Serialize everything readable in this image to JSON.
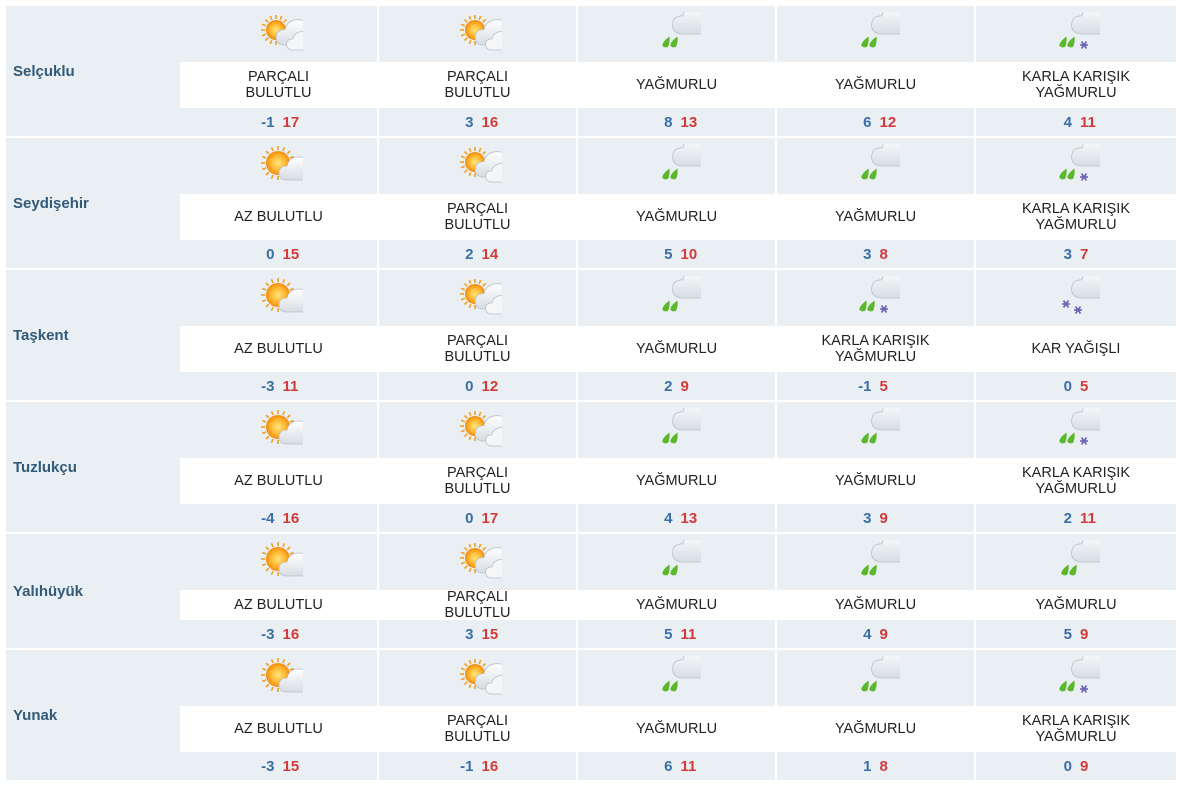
{
  "rows": [
    {
      "city": "Selçuklu",
      "days": [
        {
          "icon": "partly-cloudy-icon",
          "cond": "PARÇALI BULUTLU",
          "min": "-1",
          "max": "17"
        },
        {
          "icon": "partly-cloudy-icon",
          "cond": "PARÇALI BULUTLU",
          "min": "3",
          "max": "16"
        },
        {
          "icon": "rain-icon",
          "cond": "YAĞMURLU",
          "min": "8",
          "max": "13"
        },
        {
          "icon": "rain-icon",
          "cond": "YAĞMURLU",
          "min": "6",
          "max": "12"
        },
        {
          "icon": "sleet-icon",
          "cond": "KARLA KARIŞIK YAĞMURLU",
          "min": "4",
          "max": "11"
        }
      ]
    },
    {
      "city": "Seydişehir",
      "days": [
        {
          "icon": "mostly-sunny-icon",
          "cond": "AZ BULUTLU",
          "min": "0",
          "max": "15"
        },
        {
          "icon": "partly-cloudy-icon",
          "cond": "PARÇALI BULUTLU",
          "min": "2",
          "max": "14"
        },
        {
          "icon": "rain-icon",
          "cond": "YAĞMURLU",
          "min": "5",
          "max": "10"
        },
        {
          "icon": "rain-icon",
          "cond": "YAĞMURLU",
          "min": "3",
          "max": "8"
        },
        {
          "icon": "sleet-icon",
          "cond": "KARLA KARIŞIK YAĞMURLU",
          "min": "3",
          "max": "7"
        }
      ]
    },
    {
      "city": "Taşkent",
      "days": [
        {
          "icon": "mostly-sunny-icon",
          "cond": "AZ BULUTLU",
          "min": "-3",
          "max": "11"
        },
        {
          "icon": "partly-cloudy-icon",
          "cond": "PARÇALI BULUTLU",
          "min": "0",
          "max": "12"
        },
        {
          "icon": "rain-icon",
          "cond": "YAĞMURLU",
          "min": "2",
          "max": "9"
        },
        {
          "icon": "sleet-icon",
          "cond": "KARLA KARIŞIK YAĞMURLU",
          "min": "-1",
          "max": "5"
        },
        {
          "icon": "snow-icon",
          "cond": "KAR YAĞIŞLI",
          "min": "0",
          "max": "5"
        }
      ]
    },
    {
      "city": "Tuzlukçu",
      "days": [
        {
          "icon": "mostly-sunny-icon",
          "cond": "AZ BULUTLU",
          "min": "-4",
          "max": "16"
        },
        {
          "icon": "partly-cloudy-icon",
          "cond": "PARÇALI BULUTLU",
          "min": "0",
          "max": "17"
        },
        {
          "icon": "rain-icon",
          "cond": "YAĞMURLU",
          "min": "4",
          "max": "13"
        },
        {
          "icon": "rain-icon",
          "cond": "YAĞMURLU",
          "min": "3",
          "max": "9"
        },
        {
          "icon": "sleet-icon",
          "cond": "KARLA KARIŞIK YAĞMURLU",
          "min": "2",
          "max": "11"
        }
      ]
    },
    {
      "city": "Yalıhüyük",
      "days": [
        {
          "icon": "mostly-sunny-icon",
          "cond": "AZ BULUTLU",
          "min": "-3",
          "max": "16"
        },
        {
          "icon": "partly-cloudy-icon",
          "cond": "PARÇALI BULUTLU",
          "min": "3",
          "max": "15"
        },
        {
          "icon": "rain-icon",
          "cond": "YAĞMURLU",
          "min": "5",
          "max": "11"
        },
        {
          "icon": "rain-icon",
          "cond": "YAĞMURLU",
          "min": "4",
          "max": "9"
        },
        {
          "icon": "rain-icon",
          "cond": "YAĞMURLU",
          "min": "5",
          "max": "9"
        }
      ]
    },
    {
      "city": "Yunak",
      "days": [
        {
          "icon": "mostly-sunny-icon",
          "cond": "AZ BULUTLU",
          "min": "-3",
          "max": "15"
        },
        {
          "icon": "partly-cloudy-icon",
          "cond": "PARÇALI BULUTLU",
          "min": "-1",
          "max": "16"
        },
        {
          "icon": "rain-icon",
          "cond": "YAĞMURLU",
          "min": "6",
          "max": "11"
        },
        {
          "icon": "rain-icon",
          "cond": "YAĞMURLU",
          "min": "1",
          "max": "8"
        },
        {
          "icon": "sleet-icon",
          "cond": "KARLA KARIŞIK YAĞMURLU",
          "min": "0",
          "max": "9"
        }
      ]
    }
  ]
}
